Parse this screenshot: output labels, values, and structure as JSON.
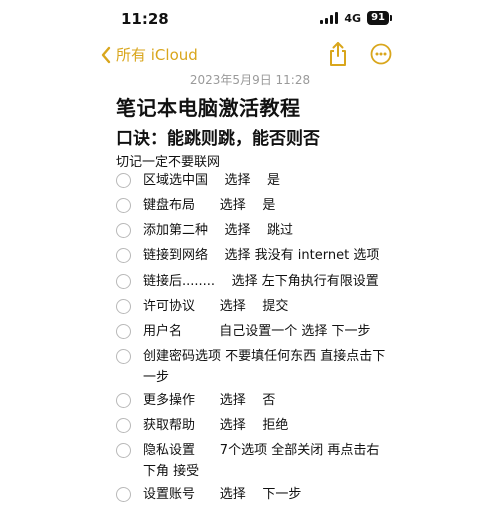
{
  "status_bar": {
    "time": "11:28",
    "network": "4G",
    "battery": "91"
  },
  "nav": {
    "back_label": "所有 iCloud"
  },
  "note": {
    "timestamp": "2023年5月9日 11:28",
    "title": "笔记本电脑激活教程",
    "subtitle": "口诀：能跳则跳，能否则否",
    "warning": "切记一定不要联网",
    "checklist": [
      "区域选中国    选择    是",
      "键盘布局      选择    是",
      "添加第二种    选择    跳过",
      "链接到网络    选择 我没有 internet 选项",
      "链接后........    选择 左下角执行有限设置",
      "许可协议      选择    提交",
      "用户名         自己设置一个 选择 下一步",
      "创建密码选项 不要填任何东西 直接点击下一步",
      "更多操作      选择    否",
      "获取帮助      选择    拒绝",
      "隐私设置      7个选项 全部关闭 再点击右下角 接受",
      "设置账号      选择    下一步"
    ]
  },
  "colors": {
    "accent": "#d9a61c",
    "timestamp": "#9a9a9a",
    "checkbox": "#b8b8b8"
  },
  "icons": [
    "chevron-left-icon",
    "share-icon",
    "more-icon",
    "signal-icon",
    "battery-icon"
  ]
}
